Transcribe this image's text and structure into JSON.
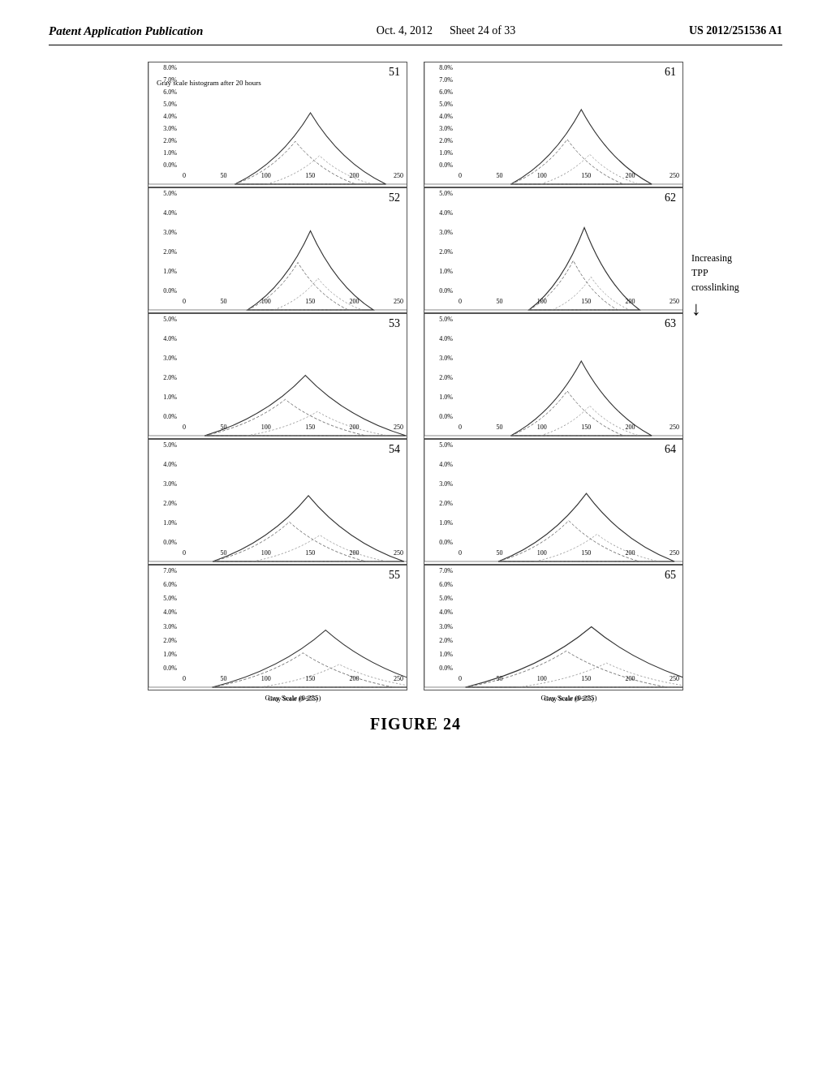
{
  "header": {
    "left": "Patent Application Publication",
    "center_date": "Oct. 4, 2012",
    "center_sheet": "Sheet 24 of 33",
    "right": "US 2012/251536 A1"
  },
  "figure_caption": "FIGURE 24",
  "side_annotation": {
    "text": "Increasing\nTPP\ncrosslinking",
    "arrow": "↓"
  },
  "charts_left": [
    {
      "id": "51",
      "annotation": "Gray scale\nhistogram after\n20 hours",
      "y_max": "8.0%",
      "y_ticks": [
        "8.0%",
        "7.0%",
        "6.0%",
        "5.0%",
        "4.0%",
        "3.0%",
        "2.0%",
        "1.0%",
        "0.0%"
      ],
      "x_ticks": [
        "0",
        "50",
        "100",
        "150",
        "200",
        "250"
      ],
      "peak_x": 160,
      "peak_y": 0.65,
      "peak_width": 30
    },
    {
      "id": "52",
      "y_max": "5.0%",
      "y_ticks": [
        "5.0%",
        "4.0%",
        "3.0%",
        "2.0%",
        "1.0%",
        "0.0%"
      ],
      "x_ticks": [
        "0",
        "50",
        "100",
        "150",
        "200",
        "250"
      ],
      "peak_x": 160,
      "peak_y": 0.72,
      "peak_width": 25
    },
    {
      "id": "53",
      "y_max": "5.0%",
      "y_ticks": [
        "5.0%",
        "4.0%",
        "3.0%",
        "2.0%",
        "1.0%",
        "0.0%"
      ],
      "x_ticks": [
        "0",
        "50",
        "100",
        "150",
        "200",
        "250"
      ],
      "peak_x": 155,
      "peak_y": 0.55,
      "peak_width": 40
    },
    {
      "id": "54",
      "y_max": "5.0%",
      "y_ticks": [
        "5.0%",
        "4.0%",
        "3.0%",
        "2.0%",
        "1.0%",
        "0.0%"
      ],
      "x_ticks": [
        "0",
        "50",
        "100",
        "150",
        "200",
        "250"
      ],
      "peak_x": 158,
      "peak_y": 0.6,
      "peak_width": 38
    },
    {
      "id": "55",
      "y_max": "7.0%",
      "y_ticks": [
        "7.0%",
        "6.0%",
        "5.0%",
        "4.0%",
        "3.0%",
        "2.0%",
        "1.0%",
        "0.0%"
      ],
      "x_ticks": [
        "0",
        "50",
        "100",
        "150",
        "200",
        "250"
      ],
      "x_label": "Gray Scale (0-255)",
      "peak_x": 175,
      "peak_y": 0.52,
      "peak_width": 45
    }
  ],
  "charts_right": [
    {
      "id": "61",
      "y_max": "8.0%",
      "y_ticks": [
        "8.0%",
        "7.0%",
        "6.0%",
        "5.0%",
        "4.0%",
        "3.0%",
        "2.0%",
        "1.0%",
        "0.0%"
      ],
      "x_ticks": [
        "0",
        "50",
        "100",
        "150",
        "200",
        "250"
      ],
      "peak_x": 155,
      "peak_y": 0.68,
      "peak_width": 28
    },
    {
      "id": "62",
      "y_max": "5.0%",
      "y_ticks": [
        "5.0%",
        "4.0%",
        "3.0%",
        "2.0%",
        "1.0%",
        "0.0%"
      ],
      "x_ticks": [
        "0",
        "50",
        "100",
        "150",
        "200",
        "250"
      ],
      "peak_x": 158,
      "peak_y": 0.75,
      "peak_width": 22
    },
    {
      "id": "63",
      "y_max": "5.0%",
      "y_ticks": [
        "5.0%",
        "4.0%",
        "3.0%",
        "2.0%",
        "1.0%",
        "0.0%"
      ],
      "x_ticks": [
        "0",
        "50",
        "100",
        "150",
        "200",
        "250"
      ],
      "peak_x": 155,
      "peak_y": 0.68,
      "peak_width": 28
    },
    {
      "id": "64",
      "y_max": "5.0%",
      "y_ticks": [
        "5.0%",
        "4.0%",
        "3.0%",
        "2.0%",
        "1.0%",
        "0.0%"
      ],
      "x_ticks": [
        "0",
        "50",
        "100",
        "150",
        "200",
        "250"
      ],
      "peak_x": 160,
      "peak_y": 0.62,
      "peak_width": 35
    },
    {
      "id": "65",
      "y_max": "7.0%",
      "y_ticks": [
        "7.0%",
        "6.0%",
        "5.0%",
        "4.0%",
        "3.0%",
        "2.0%",
        "1.0%",
        "0.0%"
      ],
      "x_ticks": [
        "0",
        "50",
        "100",
        "150",
        "200",
        "250"
      ],
      "x_label": "Gray Scale (0-255)",
      "peak_x": 165,
      "peak_y": 0.55,
      "peak_width": 50
    }
  ]
}
